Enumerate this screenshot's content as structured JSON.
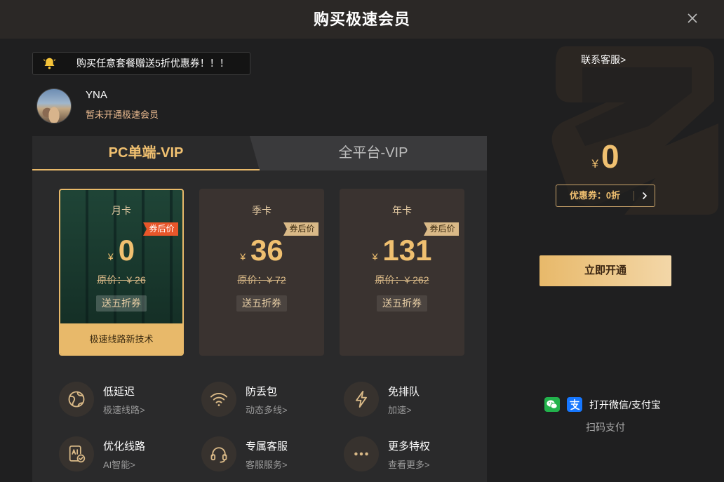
{
  "header": {
    "title": "购买极速会员"
  },
  "promo": {
    "text": "购买任意套餐赠送5折优惠券！！！",
    "icon": "bell-icon"
  },
  "user": {
    "name": "YNA",
    "status": "暂未开通极速会员"
  },
  "tabs": [
    {
      "label": "PC单端-VIP",
      "active": true
    },
    {
      "label": "全平台-VIP",
      "active": false
    }
  ],
  "plans": [
    {
      "name": "月卡",
      "badge": "券后价",
      "currency": "¥",
      "price": "0",
      "original_price": "原价：¥ 26",
      "coupon": "送五折券",
      "footer": "极速线路新技术",
      "selected": true
    },
    {
      "name": "季卡",
      "badge": "券后价",
      "currency": "¥",
      "price": "36",
      "original_price": "原价：¥ 72",
      "coupon": "送五折券",
      "selected": false
    },
    {
      "name": "年卡",
      "badge": "券后价",
      "currency": "¥",
      "price": "131",
      "original_price": "原价：¥ 262",
      "coupon": "送五折券",
      "selected": false
    }
  ],
  "features": [
    {
      "title": "低延迟",
      "link": "极速线路>",
      "icon": "globe-icon"
    },
    {
      "title": "防丢包",
      "link": "动态多线>",
      "icon": "wifi-icon"
    },
    {
      "title": "免排队",
      "link": "加速>",
      "icon": "bolt-icon"
    },
    {
      "title": "优化线路",
      "link": "AI智能>",
      "icon": "ai-check-icon"
    },
    {
      "title": "专属客服",
      "link": "客服服务>",
      "icon": "headset-icon"
    },
    {
      "title": "更多特权",
      "link": "查看更多>",
      "icon": "more-dots-icon"
    }
  ],
  "checkout": {
    "contact": "联系客服>",
    "currency": "¥",
    "price": "0",
    "coupon_label": "优惠券：0折",
    "buy_label": "立即开通",
    "pay_hint": "打开微信/支付宝",
    "pay_method": "扫码支付"
  },
  "colors": {
    "accent": "#e8b96a",
    "price_gold": "#f0c070",
    "badge_selected": "#e8562a",
    "badge_default": "#d9b987",
    "page_bg": "#1f1f20",
    "panel_bg": "#2a2a2b",
    "card_bg": "#3a3330"
  }
}
